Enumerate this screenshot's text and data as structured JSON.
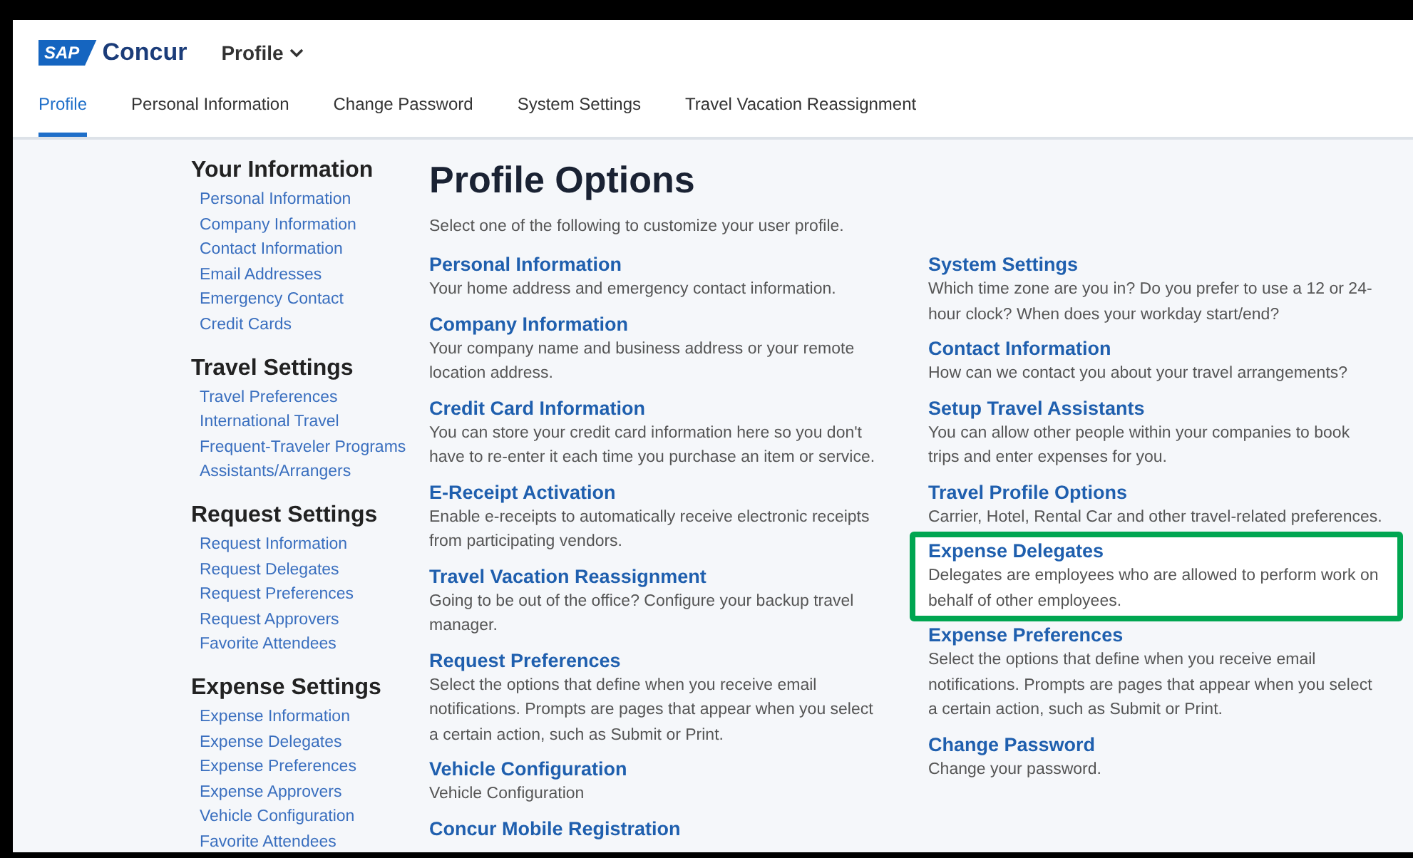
{
  "header": {
    "logo_mark": "SAP",
    "logo_name": "Concur",
    "menu": "Profile"
  },
  "tabs": [
    {
      "label": "Profile",
      "selected": true
    },
    {
      "label": "Personal Information",
      "selected": false
    },
    {
      "label": "Change Password",
      "selected": false
    },
    {
      "label": "System Settings",
      "selected": false
    },
    {
      "label": "Travel Vacation Reassignment",
      "selected": false
    }
  ],
  "sidebar": [
    {
      "heading": "Your Information",
      "links": [
        "Personal Information",
        "Company Information",
        "Contact Information",
        "Email Addresses",
        "Emergency Contact",
        "Credit Cards"
      ]
    },
    {
      "heading": "Travel Settings",
      "links": [
        "Travel Preferences",
        "International Travel",
        "Frequent-Traveler Programs",
        "Assistants/Arrangers"
      ]
    },
    {
      "heading": "Request Settings",
      "links": [
        "Request Information",
        "Request Delegates",
        "Request Preferences",
        "Request Approvers",
        "Favorite Attendees"
      ]
    },
    {
      "heading": "Expense Settings",
      "links": [
        "Expense Information",
        "Expense Delegates",
        "Expense Preferences",
        "Expense Approvers",
        "Vehicle Configuration",
        "Favorite Attendees"
      ]
    }
  ],
  "main": {
    "title": "Profile Options",
    "intro": "Select one of the following to customize your user profile.",
    "columns": [
      [
        {
          "title": "Personal Information",
          "description": "Your home address and emergency contact information.",
          "highlighted": false
        },
        {
          "title": "Company Information",
          "description": "Your company name and business address or your remote location address.",
          "highlighted": false
        },
        {
          "title": "Credit Card Information",
          "description": "You can store your credit card information here so you don't have to re-enter it each time you purchase an item or service.",
          "highlighted": false
        },
        {
          "title": "E-Receipt Activation",
          "description": "Enable e-receipts to automatically receive electronic receipts from participating vendors.",
          "highlighted": false
        },
        {
          "title": "Travel Vacation Reassignment",
          "description": "Going to be out of the office? Configure your backup travel manager.",
          "highlighted": false
        },
        {
          "title": "Request Preferences",
          "description": "Select the options that define when you receive email notifications. Prompts are pages that appear when you select a certain action, such as Submit or Print.",
          "highlighted": false
        },
        {
          "title": "Vehicle Configuration",
          "description": "Vehicle Configuration",
          "highlighted": false
        },
        {
          "title": "Concur Mobile Registration",
          "highlighted": false
        }
      ],
      [
        {
          "title": "System Settings",
          "description": "Which time zone are you in? Do you prefer to use a 12 or 24-hour clock? When does your workday start/end?",
          "highlighted": false
        },
        {
          "title": "Contact Information",
          "description": "How can we contact you about your travel arrangements?",
          "highlighted": false
        },
        {
          "title": "Setup Travel Assistants",
          "description": "You can allow other people within your companies to book trips and enter expenses for you.",
          "highlighted": false
        },
        {
          "title": "Travel Profile Options",
          "description": "Carrier, Hotel, Rental Car and other travel-related preferences.",
          "highlighted": false
        },
        {
          "title": "Expense Delegates",
          "description": "Delegates are employees who are allowed to perform work on behalf of other employees.",
          "highlighted": true
        },
        {
          "title": "Expense Preferences",
          "description": "Select the options that define when you receive email notifications. Prompts are pages that appear when you select a certain action, such as Submit or Print.",
          "highlighted": false
        },
        {
          "title": "Change Password",
          "description": "Change your password.",
          "highlighted": false
        }
      ]
    ]
  }
}
